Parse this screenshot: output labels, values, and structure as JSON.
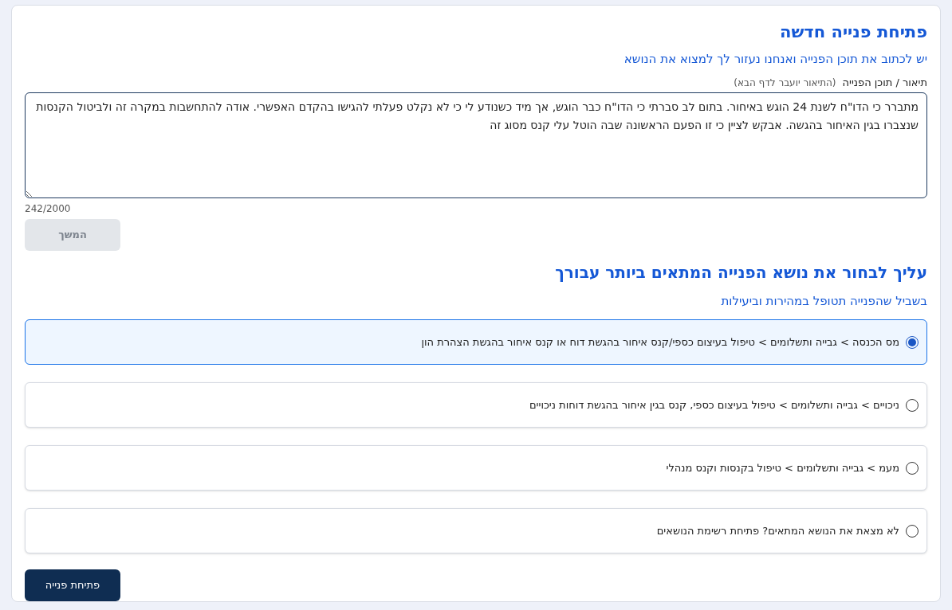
{
  "form": {
    "title": "פתיחת פנייה חדשה",
    "subtitle": "יש לכתוב את תוכן הפנייה ואנחנו נעזור לך למצוא את הנושא",
    "field_label": "תיאור / תוכן הפנייה",
    "field_hint": "(התיאור יועבר לדף הבא)",
    "description": {
      "value": "מתברר כי הדו\"ח לשנת 24 הוגש באיחור. בתום לב סברתי כי הדו\"ח כבר הוגש, אך מיד כשנודע לי כי לא נקלט פעלתי להגישו בהקדם האפשרי. אודה להתחשבות במקרה זה ולביטול הקנסות שנצברו בגין האיחור בהגשה. אבקש לציין כי זו הפעם הראשונה שבה הוטל עלי קנס מסוג זה",
      "counter": "242/2000"
    },
    "continue_button": {
      "label": "המשך",
      "disabled": true
    }
  },
  "topics": {
    "title": "עליך לבחור את נושא הפנייה המתאים ביותר עבורך",
    "subtitle": "בשביל שהפנייה תטופל במהירות וביעילות",
    "options": [
      {
        "label": "מס הכנסה > גבייה ותשלומים > טיפול בעיצום כספי/קנס איחור בהגשת דוח או קנס איחור בהגשת הצהרת הון",
        "selected": true
      },
      {
        "label": "ניכויים > גבייה ותשלומים > טיפול בעיצום כספי, קנס בגין איחור בהגשת דוחות ניכויים",
        "selected": false
      },
      {
        "label": "מעמ > גבייה ותשלומים > טיפול בקנסות וקנס מנהלי",
        "selected": false
      },
      {
        "label": "לא מצאת את הנושא המתאים? פתיחת רשימת הנושאים",
        "selected": false
      }
    ],
    "submit_button": "פתיחת פנייה"
  }
}
